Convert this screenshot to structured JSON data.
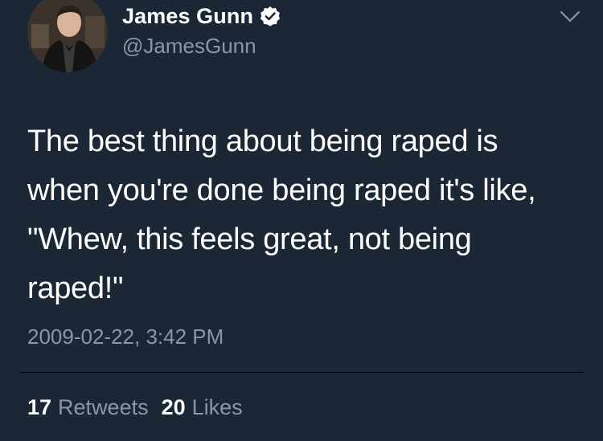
{
  "user": {
    "display_name": "James Gunn",
    "handle": "@JamesGunn",
    "verified_icon": "verified-badge-icon",
    "avatar_icon": "profile-photo"
  },
  "menu": {
    "icon": "chevron-down-icon"
  },
  "tweet": {
    "text": "The best thing about being raped is\nwhen you're done being raped it's like,\n\"Whew, this feels great, not being\nraped!\"",
    "timestamp": "2009-02-22, 3:42 PM"
  },
  "stats": {
    "retweets_count": "17",
    "retweets_label": "Retweets",
    "likes_count": "20",
    "likes_label": "Likes"
  },
  "colors": {
    "background": "#1b2734",
    "primary_text": "#ffffff",
    "secondary_text": "#8899a6"
  }
}
